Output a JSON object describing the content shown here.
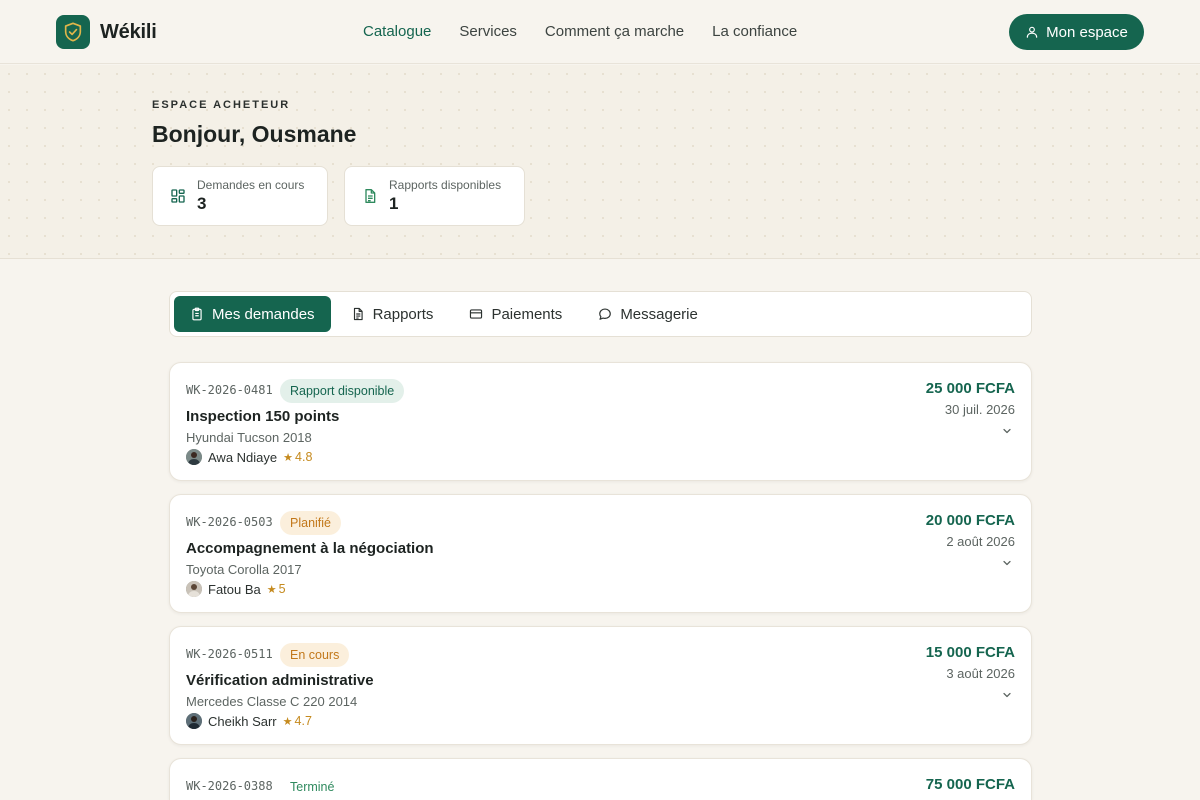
{
  "brand": {
    "name": "Wékili"
  },
  "nav": [
    {
      "label": "Catalogue",
      "active": true
    },
    {
      "label": "Services"
    },
    {
      "label": "Comment ça marche"
    },
    {
      "label": "La confiance"
    }
  ],
  "account_button": "Mon espace",
  "hero": {
    "eyebrow": "ESPACE ACHETEUR",
    "greeting": "Bonjour, Ousmane",
    "stats": [
      {
        "label": "Demandes en cours",
        "value": "3",
        "icon": "grid-icon"
      },
      {
        "label": "Rapports disponibles",
        "value": "1",
        "icon": "document-icon"
      }
    ]
  },
  "tabs": [
    {
      "label": "Mes demandes",
      "icon": "clipboard-icon",
      "active": true
    },
    {
      "label": "Rapports",
      "icon": "document-icon"
    },
    {
      "label": "Paiements",
      "icon": "credit-card-icon"
    },
    {
      "label": "Messagerie",
      "icon": "chat-bubble-icon"
    }
  ],
  "requests": [
    {
      "ref": "WK-2026-0481",
      "status": "Rapport disponible",
      "status_kind": "report",
      "title": "Inspection 150 points",
      "vehicle": "Hyundai Tucson 2018",
      "inspector": "Awa Ndiaye",
      "rating": "4.8",
      "price": "25 000 FCFA",
      "date": "30 juil. 2026"
    },
    {
      "ref": "WK-2026-0503",
      "status": "Planifié",
      "status_kind": "planned",
      "title": "Accompagnement à la négociation",
      "vehicle": "Toyota Corolla 2017",
      "inspector": "Fatou Ba",
      "rating": "5",
      "price": "20 000 FCFA",
      "date": "2 août 2026"
    },
    {
      "ref": "WK-2026-0511",
      "status": "En cours",
      "status_kind": "progress",
      "title": "Vérification administrative",
      "vehicle": "Mercedes Classe C 220 2014",
      "inspector": "Cheikh Sarr",
      "rating": "4.7",
      "price": "15 000 FCFA",
      "date": "3 août 2026"
    },
    {
      "ref": "WK-2026-0388",
      "status": "Terminé",
      "status_kind": "done",
      "title": "",
      "vehicle": "",
      "inspector": "",
      "rating": "",
      "price": "75 000 FCFA",
      "date": ""
    }
  ],
  "colors": {
    "brand": "#15654f",
    "background": "#f7f4ee",
    "star": "#c58a1e",
    "badge_report_bg": "#e3f0ea",
    "badge_report_fg": "#15654f",
    "badge_planned_bg": "#fbefdc",
    "badge_planned_fg": "#c2781a",
    "badge_progress_bg": "#fbefdc",
    "badge_progress_fg": "#c2781a",
    "badge_done_bg": "#ffffff",
    "badge_done_fg": "#2f8a5e"
  }
}
